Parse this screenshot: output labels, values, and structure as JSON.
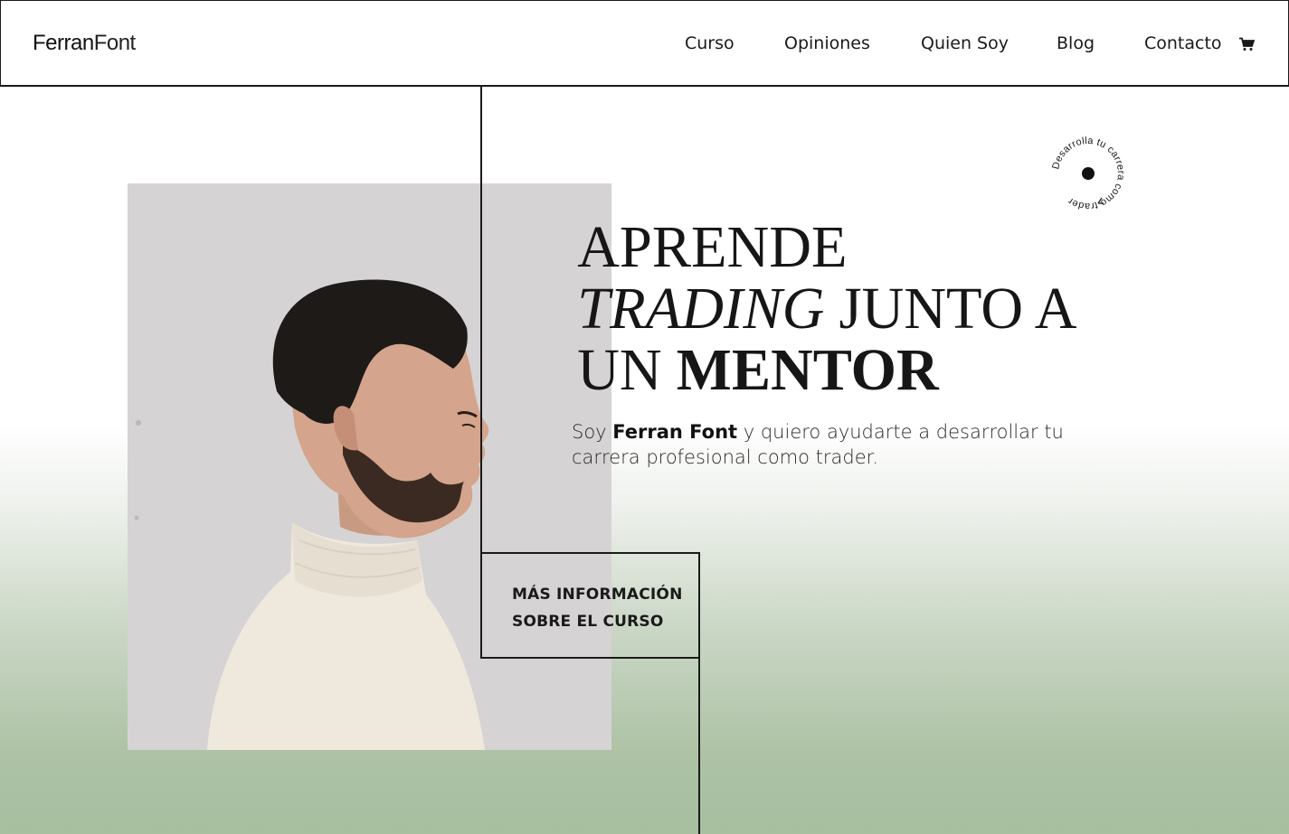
{
  "header": {
    "logo_bold": "Ferran",
    "logo_light": "Font",
    "nav": [
      {
        "label": "Curso"
      },
      {
        "label": "Opiniones"
      },
      {
        "label": "Quien Soy"
      },
      {
        "label": "Blog"
      },
      {
        "label": "Contacto"
      }
    ],
    "cart_icon": "shopping-cart-icon"
  },
  "hero": {
    "headline_line1": "APRENDE",
    "headline_line2_italic": "TRADING",
    "headline_line2_rest": " JUNTO A",
    "headline_line3_light": "UN ",
    "headline_line3_bold": "MENTOR",
    "subtitle_pre": "Soy ",
    "subtitle_name": "Ferran Font",
    "subtitle_post": " y quiero ayudarte a desarrollar tu carrera profesional como trader.",
    "cta_line1": "MÁS INFORMACIÓN",
    "cta_line2": "SOBRE EL CURSO",
    "badge_text": "Desarrolla tu carrera como trader",
    "photo_icon": "mentor-portrait-photo"
  },
  "colors": {
    "text": "#1a1a1a",
    "photo_bg": "#d5d2d3",
    "gradient_bottom": "#a7be9f",
    "sweater": "#efe9dd"
  }
}
